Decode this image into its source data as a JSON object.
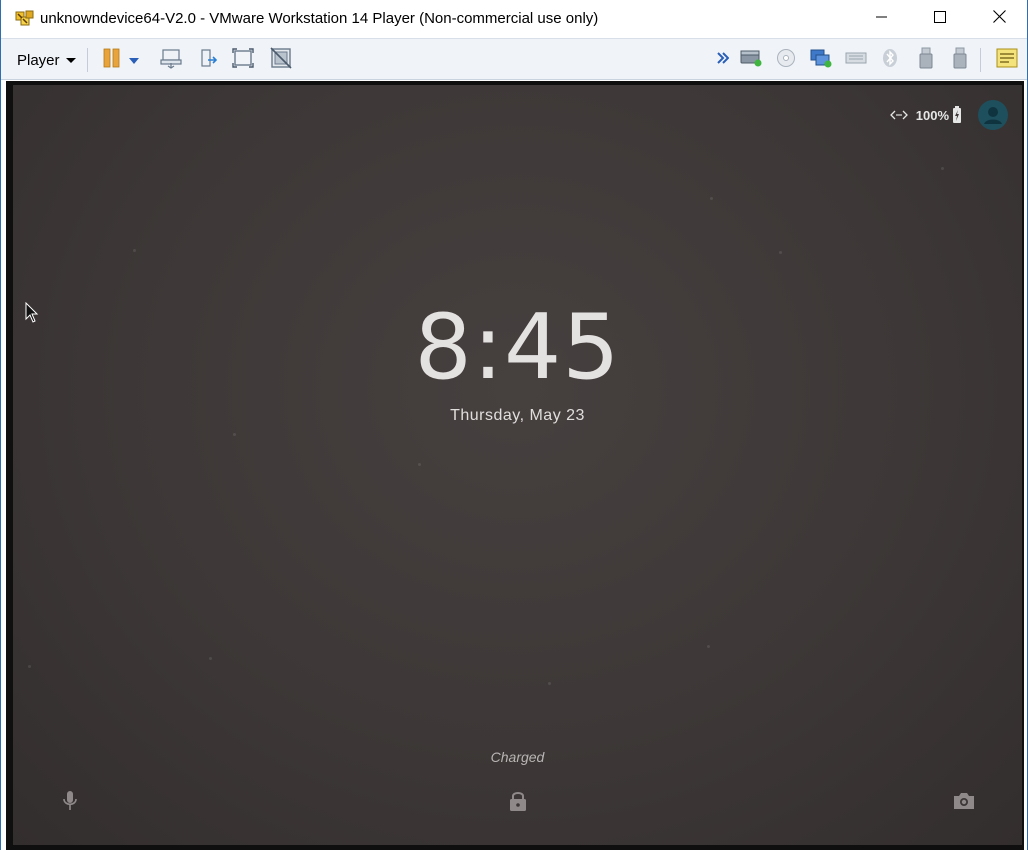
{
  "window": {
    "title": "unknowndevice64-V2.0 - VMware Workstation 14 Player (Non-commercial use only)",
    "icon": "vmware-player-icon",
    "controls": [
      "minimize-icon",
      "maximize-icon",
      "close-icon"
    ]
  },
  "toolbar": {
    "player_label": "Player",
    "icons": [
      "pause-icon",
      "pause-dropdown-icon",
      "send-ctrl-alt-del-icon",
      "removable-devices-icon",
      "fullscreen-icon",
      "unity-icon"
    ],
    "device_icons": [
      "more-devices-icon",
      "hard-disk-icon",
      "cd-dvd-icon",
      "network-adapter-icon",
      "sound-card-icon",
      "bluetooth-icon",
      "usb-device-icon",
      "usb-device-icon",
      "message-log-icon"
    ],
    "colors": {
      "pause": "#e8a33c",
      "chevron": "#2a5fb8"
    }
  },
  "lockscreen": {
    "status": {
      "battery_percent": "100%"
    },
    "clock": "8:45",
    "date": "Thursday, May 23",
    "charging_status": "Charged",
    "icons": [
      "signal-icon",
      "battery-charging-icon",
      "user-avatar-icon",
      "microphone-icon",
      "lock-icon",
      "camera-icon"
    ],
    "colors": {
      "background": "#3d3837",
      "text": "#e4e2e1",
      "avatar": "#1e4f5c"
    }
  }
}
